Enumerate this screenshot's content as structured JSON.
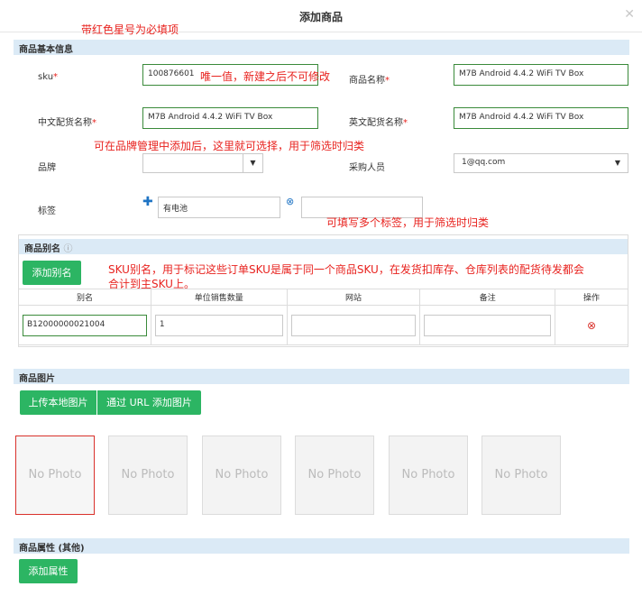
{
  "header": {
    "title": "添加商品",
    "close_icon": "close-icon"
  },
  "notes": {
    "required_hint": "带红色星号为必填项",
    "sku_hint": "唯一值，新建之后不可修改",
    "brand_hint": "可在品牌管理中添加后，这里就可选择，用于筛选时归类",
    "tags_hint": "可填写多个标签，用于筛选时归类",
    "alias_hint_line1": "SKU别名，用于标记这些订单SKU是属于同一个商品SKU，在发货扣库存、仓库列表的配货待发都会",
    "alias_hint_line2": "合计到主SKU上。"
  },
  "basic": {
    "section_title": "商品基本信息",
    "sku_label": "sku",
    "sku_value": "100876601",
    "name_label": "商品名称",
    "name_value": "M7B Android 4.4.2  WiFi TV Box",
    "cn_name_label": "中文配货名称",
    "cn_name_value": "M7B Android 4.4.2  WiFi TV Box",
    "en_name_label": "英文配货名称",
    "en_name_value": "M7B Android 4.4.2  WiFi TV Box",
    "brand_label": "品牌",
    "brand_value": "",
    "buyer_label": "采购人员",
    "buyer_value": "1@qq.com",
    "tag_label": "标签",
    "tag_value": "有电池",
    "tag_new_value": "",
    "required_mark": "*"
  },
  "alias": {
    "section_title": "商品别名",
    "add_button": "添加别名",
    "columns": [
      "别名",
      "单位销售数量",
      "网站",
      "备注",
      "操作"
    ],
    "rows": [
      {
        "alias": "B12000000021004",
        "qty": "1",
        "site": "",
        "remark": ""
      }
    ]
  },
  "images": {
    "section_title": "商品图片",
    "upload_local": "上传本地图片",
    "upload_url": "通过 URL 添加图片",
    "placeholders": [
      "No Photo",
      "No Photo",
      "No Photo",
      "No Photo",
      "No Photo",
      "No Photo"
    ]
  },
  "attributes": {
    "section_title": "商品属性 (其他)",
    "add_button": "添加属性"
  },
  "colors": {
    "accent_green": "#2cb563",
    "section_bg": "#dbeaf6",
    "note_red": "#e8231f"
  }
}
